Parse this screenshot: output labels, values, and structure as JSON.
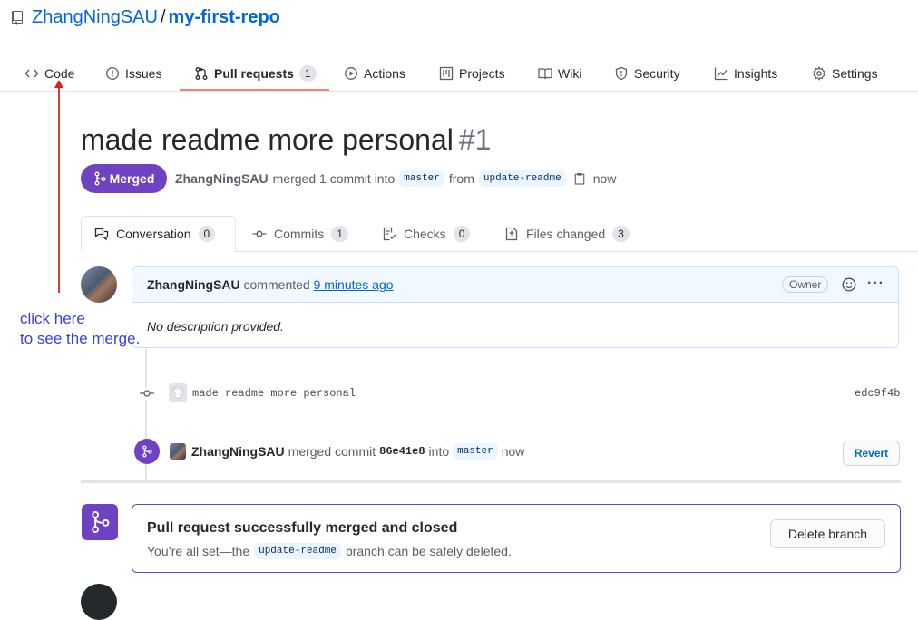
{
  "repo": {
    "owner": "ZhangNingSAU",
    "separator": "/",
    "name": "my-first-repo"
  },
  "nav": {
    "code": "Code",
    "issues": "Issues",
    "pull_requests": "Pull requests",
    "pull_requests_count": "1",
    "actions": "Actions",
    "projects": "Projects",
    "wiki": "Wiki",
    "security": "Security",
    "insights": "Insights",
    "settings": "Settings"
  },
  "pr": {
    "title": "made readme more personal",
    "number": "#1",
    "state_label": "Merged",
    "author": "ZhangNingSAU",
    "merged_text": "merged 1 commit into",
    "base_branch": "master",
    "from_text": "from",
    "head_branch": "update-readme",
    "time": "now"
  },
  "tabs": {
    "conversation": "Conversation",
    "conversation_count": "0",
    "commits": "Commits",
    "commits_count": "1",
    "checks": "Checks",
    "checks_count": "0",
    "files_changed": "Files changed",
    "files_changed_count": "3"
  },
  "comment": {
    "author": "ZhangNingSAU",
    "action": "commented",
    "time": "9 minutes ago",
    "role": "Owner",
    "more": "···",
    "body": "No description provided."
  },
  "timeline": {
    "commit_message": "made readme more personal",
    "commit_sha": "edc9f4b",
    "merge_author": "ZhangNingSAU",
    "merge_action": "merged commit",
    "merge_sha": "86e41e8",
    "merge_into": "into",
    "merge_branch": "master",
    "merge_time": "now",
    "revert_label": "Revert"
  },
  "merge_status": {
    "title": "Pull request successfully merged and closed",
    "sub_prefix": "You’re all set—the",
    "branch": "update-readme",
    "sub_suffix": "branch can be safely deleted.",
    "delete_label": "Delete branch"
  },
  "annotation": {
    "line1": "click here",
    "line2": "to see the merge.",
    "color": "#3b3fd9",
    "arrow_color": "#e02020"
  },
  "colors": {
    "merged_purple": "#6f42c1",
    "link_blue": "#0366d6",
    "nav_underline": "#f9826c"
  }
}
